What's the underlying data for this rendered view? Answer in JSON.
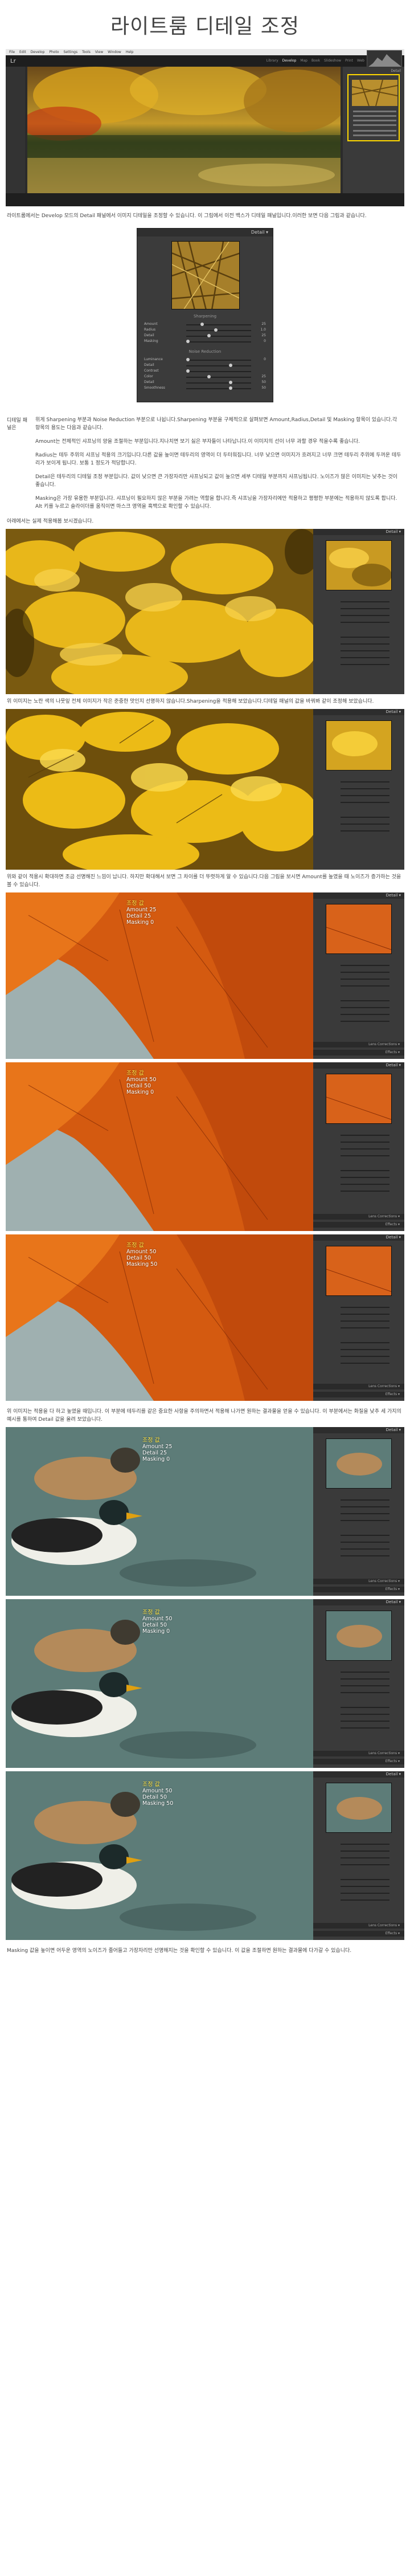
{
  "title": "라이트룸 디테일 조정",
  "lr": {
    "menu": [
      "File",
      "Edit",
      "Develop",
      "Photo",
      "Settings",
      "Tools",
      "View",
      "Window",
      "Help"
    ],
    "logo": "Lr",
    "modules": [
      "Library",
      "Develop",
      "Map",
      "Book",
      "Slideshow",
      "Print",
      "Web"
    ],
    "panel_title": "Detail"
  },
  "intro": "라이트룸에서는 Develop 모드의 Detail 패널에서 이미지 디테일을 조정할 수 있습니다. 이 그림에서 이전 백스가 디테일 패널입니다.이러한 보면 다음 그림과 같습니다.",
  "detail_panel": {
    "header": "Detail ▾",
    "sharpening": "Sharpening",
    "sliders_sharp": [
      {
        "label": "Amount",
        "value": "25",
        "pos": 0.17
      },
      {
        "label": "Radius",
        "value": "1.0",
        "pos": 0.33
      },
      {
        "label": "Detail",
        "value": "25",
        "pos": 0.25
      },
      {
        "label": "Masking",
        "value": "0",
        "pos": 0.0
      }
    ],
    "noise": "Noise Reduction",
    "sliders_noise": [
      {
        "label": "Luminance",
        "value": "0",
        "pos": 0.0
      },
      {
        "label": "Detail",
        "value": "",
        "pos": 0.5
      },
      {
        "label": "Contrast",
        "value": "",
        "pos": 0.0
      },
      {
        "label": "Color",
        "value": "25",
        "pos": 0.25
      },
      {
        "label": "Detail",
        "value": "50",
        "pos": 0.5
      },
      {
        "label": "Smoothness",
        "value": "50",
        "pos": 0.5
      }
    ]
  },
  "section1": {
    "label": "디테일 패널은",
    "p1": "위게 Sharpening 부분과 Noise Reduction 부분으로 나뉩니다.Sharpening 부분을 구체적으로 살펴보면 Amount,Radius,Detail 및 Masking 항목이 있습니다.각 항목의 용도는 다음과 같습니다.",
    "p2": "Amount는 전체적인 샤프닝의 양을 조절하는 부분입니다.지나치면 보기 싫은 부자들이 나타납니다.이 이미지의 선이 너무 과할 경우 적을수록 좋습니다.",
    "p3": "Radius는 테두 주위의 샤프닝 적용의 크기입니다.다른 값을 높이면 테두리의 영역이 더 두터워집니다. 너무 낮으면 이미지가 흐려지고 너무 크면 테두리 주위에 두꺼운 테두리가 보이게 됩니다. 보통 1 정도가 적당합니다.",
    "p4": "Detail은 테두리의 디테일 조정 부분입니다. 값이 낮으면 큰 가장자리만 샤프닝되고 값이 높으면 세부 디테일 부분까지 샤프닝됩니다. 노이즈가 많은 이미지는 낮추는 것이 좋습니다.",
    "p5": "Masking은 가장 유용한 부분입니다. 샤프닝이 필요하지 않은 부분을 가려는 역할을 합니다.즉 샤프닝을 가장자리에만 적용하고 평평한 부분에는 적용하지 않도록 합니다. Alt 키를 누르고 슬라이더를 움직이면 마스크 영역을 흑백으로 확인할 수 있습니다."
  },
  "caption_a": "아래에서는 실제 적용해봅 보시겠습니다.",
  "caption_b": "위 이미지는 노란 색의 나뭇잎 전체 이미지가 작은 준중한 맛인지 선명하지 않습니다.Sharpening을 적용해 보았습니다.디테일 패널의 값을 바꿔봐 같이 조정해 보았습니다.",
  "caption_c": "위와 같이 적용시 확대하면 조금 선명해진 느낌이 납니다. 하지만 확대해서 보면 그 차이를 더 뚜렷하게 알 수 있습니다.다음 그림을 보시면 Amount를 높였을 때 노이즈가 증가하는 것을 볼 수 있습니다.",
  "caption_d": "위 이미지는 적용을 다 하고 높였을 때입니다. 이 부분에 테두리를 같은 중요한 사항을 주의하면서 적용해 나가면 원하는 결과물을 얻을 수 있습니다. 이 부분에서는 화질을 낮추 세 가지의 예시를 통하여 Detail 값을 올려 보았습니다.",
  "caption_e": "Masking 값을 높이면 어두운 영역의 노이즈가 줄어들고 가장자리만 선명해지는 것을 확인할 수 있습니다. 이 값을 조절하면 원하는 결과물에 다가갈 수 있습니다.",
  "shots": [
    {
      "overlay": [
        "조정 값",
        "Amount 25",
        "Detail 25",
        "Masking 0"
      ]
    },
    {
      "overlay": [
        "조정 값",
        "Amount 50",
        "Detail 50",
        "Masking 0"
      ]
    },
    {
      "overlay": [
        "조정 값",
        "Amount 50",
        "Detail 50",
        "Masking 50"
      ]
    },
    {
      "overlay": [
        "조정 값",
        "Amount 25",
        "Detail 25",
        "Masking 0"
      ]
    },
    {
      "overlay": [
        "조정 값",
        "Amount 50",
        "Detail 50",
        "Masking 0"
      ]
    },
    {
      "overlay": [
        "조정 값",
        "Amount 50",
        "Detail 50",
        "Masking 50"
      ]
    }
  ],
  "shot_panel": {
    "header": "Detail ▾",
    "lens": "Lens Corrections ▾",
    "effects": "Effects ▾"
  },
  "colors": {
    "accent": "#ffd800",
    "overlay_head": "#ffe64a"
  }
}
